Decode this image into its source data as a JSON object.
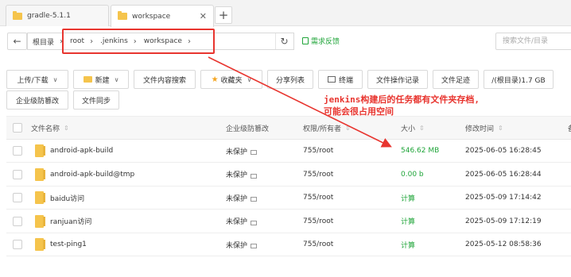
{
  "tabs": [
    {
      "label": "gradle-5.1.1"
    },
    {
      "label": "workspace",
      "close": "✕"
    }
  ],
  "tab_add": "+",
  "nav": {
    "back": "←",
    "breadcrumb": [
      "根目录",
      "root",
      ".jenkins",
      "workspace"
    ],
    "sep": "›",
    "refresh": "↻",
    "feedback": "需求反馈",
    "search_placeholder": "搜索文件/目录"
  },
  "toolbar": {
    "upload": "上传/下载",
    "new": "新建",
    "content_search": "文件内容搜索",
    "favorites": "收藏夹",
    "share_list": "分享列表",
    "terminal": "终端",
    "op_log": "文件操作记录",
    "footprint": "文件足迹",
    "disk": "/(根目录)1.7 GB",
    "tamper": "企业级防篡改",
    "sync": "文件同步",
    "caret": "∨"
  },
  "table": {
    "headers": {
      "name": "文件名称",
      "tamper": "企业级防篡改",
      "perm": "权限/所有者",
      "size": "大小",
      "mtime": "修改时间",
      "extra": "备"
    },
    "sort_glyph": "⇕",
    "rows": [
      {
        "name": "android-apk-build",
        "tamper": "未保护",
        "perm": "755/root",
        "size": "546.62 MB",
        "mtime": "2025-06-05 16:28:45"
      },
      {
        "name": "android-apk-build@tmp",
        "tamper": "未保护",
        "perm": "755/root",
        "size": "0.00 b",
        "mtime": "2025-06-05 16:28:44"
      },
      {
        "name": "baidu访问",
        "tamper": "未保护",
        "perm": "755/root",
        "size": "计算",
        "mtime": "2025-05-09 17:14:42"
      },
      {
        "name": "ranjuan访问",
        "tamper": "未保护",
        "perm": "755/root",
        "size": "计算",
        "mtime": "2025-05-09 17:12:19"
      },
      {
        "name": "test-ping1",
        "tamper": "未保护",
        "perm": "755/root",
        "size": "计算",
        "mtime": "2025-05-12 08:58:36"
      }
    ]
  },
  "annotation": {
    "line1": "jenkins构建后的任务都有文件夹存档,",
    "line2": "可能会很占用空间",
    "color": "#e8352f"
  },
  "colors": {
    "accent": "#20a53a",
    "annotation": "#e8352f",
    "folder": "#f5c44c"
  }
}
